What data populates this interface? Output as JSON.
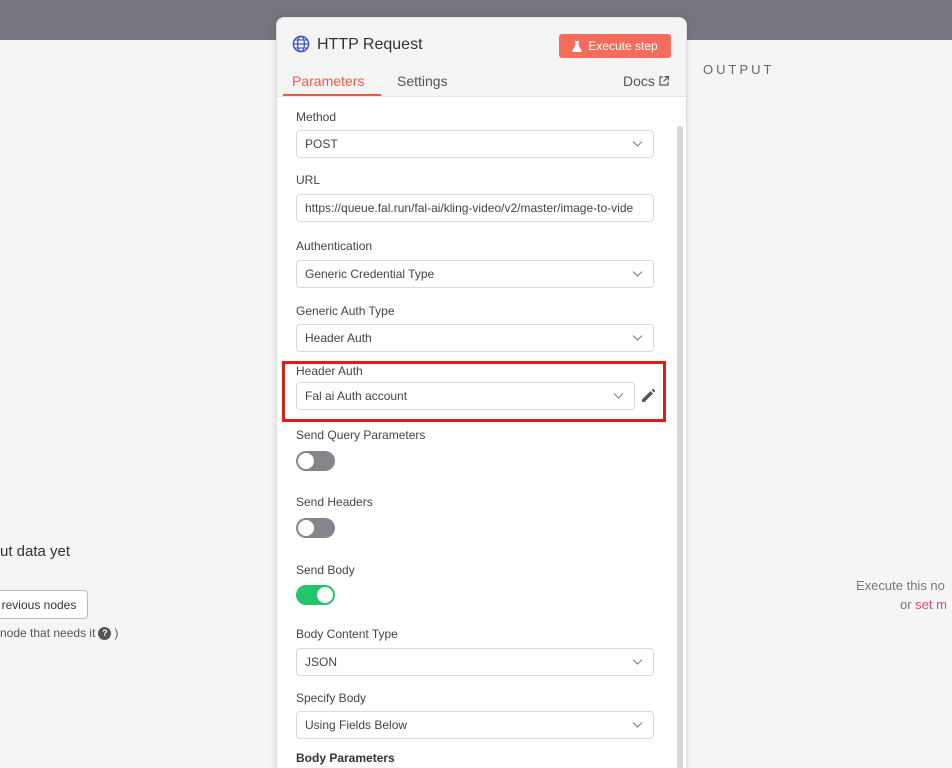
{
  "colors": {
    "accent": "#ea5a45",
    "execute_button": "#f56c5a",
    "toggle_on": "#24c46a",
    "toggle_off": "#85868c",
    "highlight": "#e01b1b",
    "link": "#ea4b71"
  },
  "input_panel": {
    "empty_title": "ut data yet",
    "prev_button": "revious nodes",
    "hint_text": "node that needs it",
    "hint_close": ")"
  },
  "output_panel": {
    "label": "OUTPUT",
    "message_line1": "Execute this no",
    "message_line2_prefix": "or ",
    "message_line2_link": "set m"
  },
  "node": {
    "icon": "globe-icon",
    "title": "HTTP Request",
    "execute_button": "Execute step",
    "tabs": {
      "parameters": "Parameters",
      "settings": "Settings",
      "docs": "Docs"
    }
  },
  "fields": {
    "method": {
      "label": "Method",
      "value": "POST"
    },
    "url": {
      "label": "URL",
      "value": "https://queue.fal.run/fal-ai/kling-video/v2/master/image-to-vide"
    },
    "authentication": {
      "label": "Authentication",
      "value": "Generic Credential Type"
    },
    "generic_auth_type": {
      "label": "Generic Auth Type",
      "value": "Header Auth"
    },
    "header_auth": {
      "label": "Header Auth",
      "value": "Fal ai Auth account"
    },
    "send_query_parameters": {
      "label": "Send Query Parameters",
      "enabled": false
    },
    "send_headers": {
      "label": "Send Headers",
      "enabled": false
    },
    "send_body": {
      "label": "Send Body",
      "enabled": true
    },
    "body_content_type": {
      "label": "Body Content Type",
      "value": "JSON"
    },
    "specify_body": {
      "label": "Specify Body",
      "value": "Using Fields Below"
    },
    "body_parameters": {
      "label": "Body Parameters"
    }
  }
}
